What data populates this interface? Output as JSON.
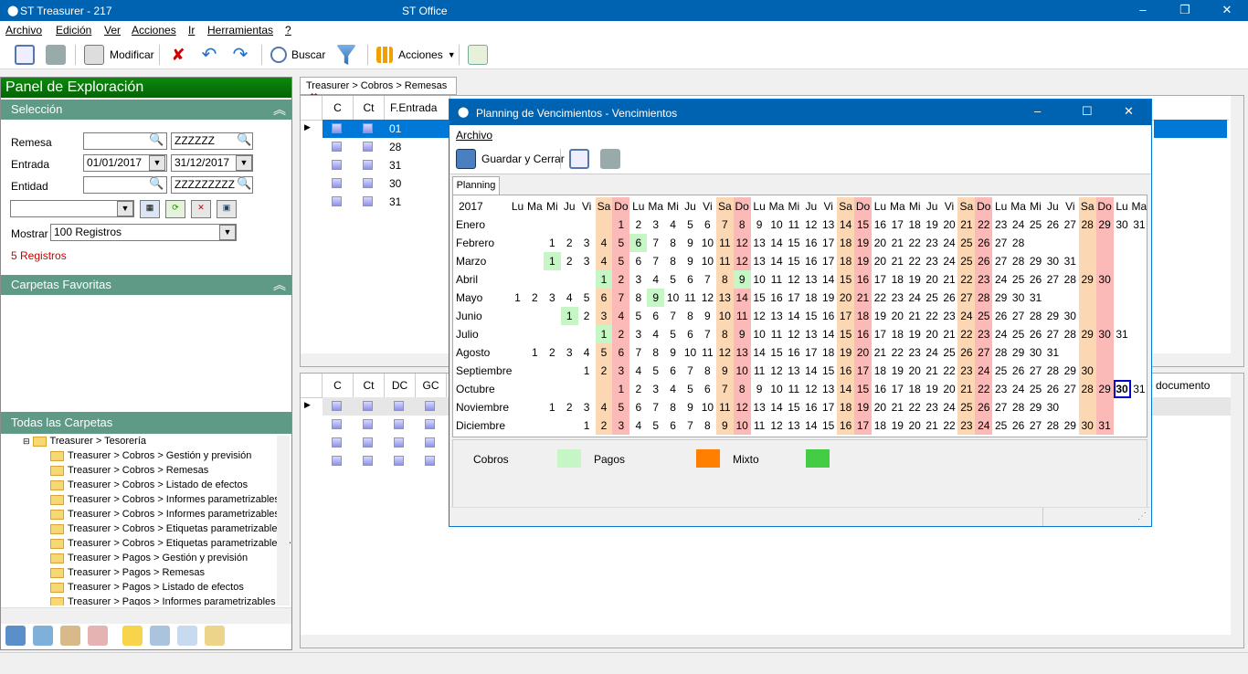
{
  "window": {
    "title": "ST Treasurer - 217",
    "app": "ST Office"
  },
  "menu": [
    "Archivo",
    "Edición",
    "Ver",
    "Acciones",
    "Ir",
    "Herramientas",
    "?"
  ],
  "toolbar": {
    "modificar": "Modificar",
    "buscar": "Buscar",
    "acciones": "Acciones"
  },
  "panel": {
    "title": "Panel de Exploración",
    "seleccion": "Selección",
    "remesa_label": "Remesa",
    "remesa_to": "ZZZZZZ",
    "entrada_label": "Entrada",
    "entrada_from": "01/01/2017",
    "entrada_to": "31/12/2017",
    "entidad_label": "Entidad",
    "entidad_to": "ZZZZZZZZZ",
    "mostrar_label": "Mostrar",
    "mostrar_value": "100 Registros",
    "registros": "5 Registros",
    "favoritas": "Carpetas Favoritas",
    "todas": "Todas las Carpetas",
    "tree": [
      "Treasurer > Tesorería",
      "Treasurer > Cobros > Gestión y previsión",
      "Treasurer > Cobros > Remesas",
      "Treasurer > Cobros > Listado de efectos",
      "Treasurer > Cobros > Informes parametrizables",
      "Treasurer > Cobros > Informes parametrizables >",
      "Treasurer > Cobros > Etiquetas parametrizables",
      "Treasurer > Cobros > Etiquetas parametrizables >",
      "Treasurer > Pagos > Gestión y previsión",
      "Treasurer > Pagos > Remesas",
      "Treasurer > Pagos > Listado de efectos",
      "Treasurer > Pagos > Informes parametrizables"
    ]
  },
  "maintab": "Treasurer > Cobros > Remesas",
  "grid1": {
    "headers": [
      "C",
      "Ct",
      "F.Entrada"
    ],
    "rows": [
      "01",
      "28",
      "31",
      "30",
      "31"
    ]
  },
  "grid2": {
    "headers": [
      "C",
      "Ct",
      "DC",
      "GC"
    ],
    "extra": "o documento"
  },
  "dialog": {
    "title": "Planning de Vencimientos - Vencimientos",
    "menu": "Archivo",
    "guardar": "Guardar y Cerrar",
    "tab": "Planning",
    "year": "2017",
    "weekdays": [
      "Lu",
      "Ma",
      "Mi",
      "Ju",
      "Vi",
      "Sa",
      "Do"
    ],
    "months": [
      "Enero",
      "Febrero",
      "Marzo",
      "Abril",
      "Mayo",
      "Junio",
      "Julio",
      "Agosto",
      "Septiembre",
      "Octubre",
      "Noviembre",
      "Diciembre"
    ],
    "legend": {
      "cobros": "Cobros",
      "pagos": "Pagos",
      "mixto": "Mixto"
    },
    "colors": {
      "cobros": "#c6f5c6",
      "pagos": "#ff7f00",
      "mixto": "#44cc44"
    }
  }
}
